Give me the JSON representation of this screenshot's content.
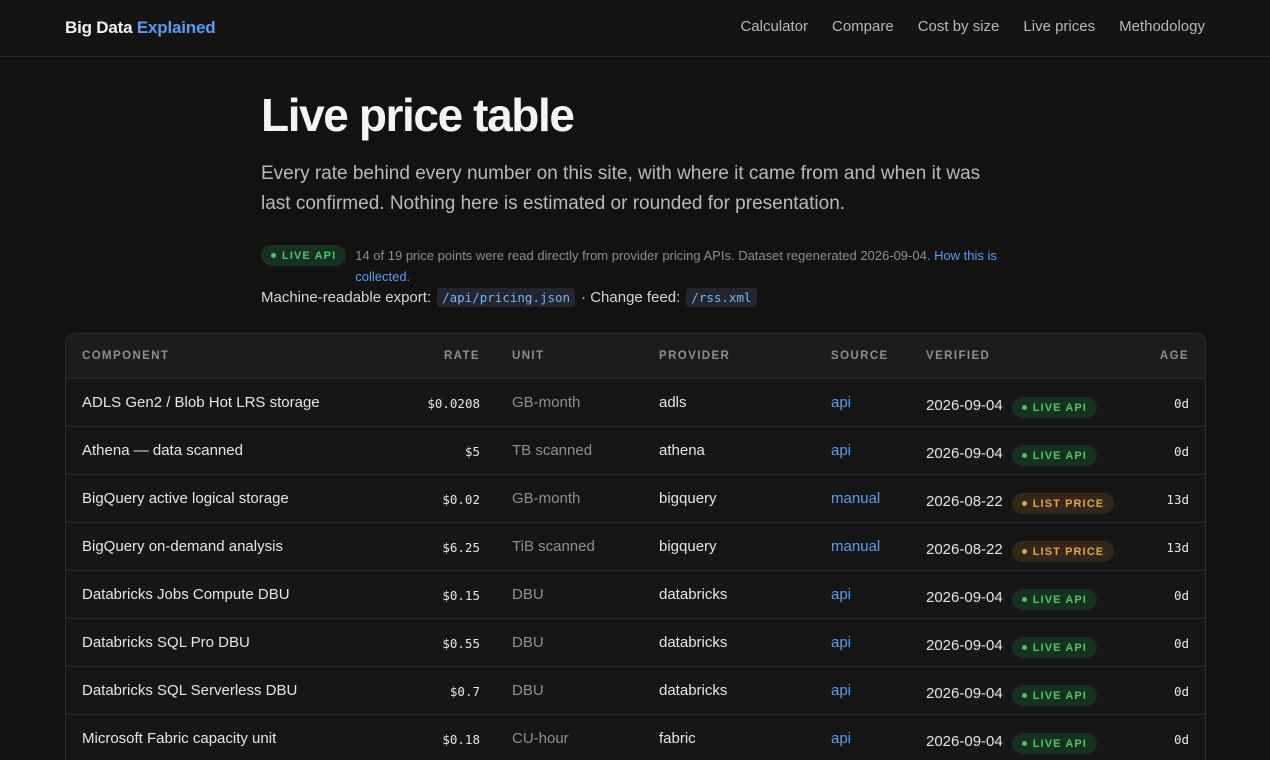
{
  "brand": {
    "name": "Big Data",
    "accent": "Explained"
  },
  "nav": [
    "Calculator",
    "Compare",
    "Cost by size",
    "Live prices",
    "Methodology"
  ],
  "page": {
    "title": "Live price table",
    "lede": "Every rate behind every number on this site, with where it came from and when it was last confirmed. Nothing here is estimated or rounded for presentation.",
    "status_badge": "LIVE API",
    "status_text": "14 of 19 price points were read directly from provider pricing APIs. Dataset regenerated 2026-09-04.",
    "status_link": "How this is collected",
    "export_label": "Machine-readable export:",
    "export_path": "/api/pricing.json",
    "feed_label": "· Change feed:",
    "feed_path": "/rss.xml"
  },
  "table": {
    "headers": {
      "component": "COMPONENT",
      "rate": "RATE",
      "unit": "UNIT",
      "provider": "PROVIDER",
      "source": "SOURCE",
      "verified": "VERIFIED",
      "age": "AGE"
    },
    "rows": [
      {
        "component": "ADLS Gen2 / Blob Hot LRS storage",
        "rate": "$0.0208",
        "unit": "GB-month",
        "provider": "adls",
        "source": "api",
        "verified": "2026-09-04",
        "badge": "LIVE API",
        "badge_type": "live",
        "age": "0d"
      },
      {
        "component": "Athena — data scanned",
        "rate": "$5",
        "unit": "TB scanned",
        "provider": "athena",
        "source": "api",
        "verified": "2026-09-04",
        "badge": "LIVE API",
        "badge_type": "live",
        "age": "0d"
      },
      {
        "component": "BigQuery active logical storage",
        "rate": "$0.02",
        "unit": "GB-month",
        "provider": "bigquery",
        "source": "manual",
        "verified": "2026-08-22",
        "badge": "LIST PRICE",
        "badge_type": "list",
        "age": "13d"
      },
      {
        "component": "BigQuery on-demand analysis",
        "rate": "$6.25",
        "unit": "TiB scanned",
        "provider": "bigquery",
        "source": "manual",
        "verified": "2026-08-22",
        "badge": "LIST PRICE",
        "badge_type": "list",
        "age": "13d"
      },
      {
        "component": "Databricks Jobs Compute DBU",
        "rate": "$0.15",
        "unit": "DBU",
        "provider": "databricks",
        "source": "api",
        "verified": "2026-09-04",
        "badge": "LIVE API",
        "badge_type": "live",
        "age": "0d"
      },
      {
        "component": "Databricks SQL Pro DBU",
        "rate": "$0.55",
        "unit": "DBU",
        "provider": "databricks",
        "source": "api",
        "verified": "2026-09-04",
        "badge": "LIVE API",
        "badge_type": "live",
        "age": "0d"
      },
      {
        "component": "Databricks SQL Serverless DBU",
        "rate": "$0.7",
        "unit": "DBU",
        "provider": "databricks",
        "source": "api",
        "verified": "2026-09-04",
        "badge": "LIVE API",
        "badge_type": "live",
        "age": "0d"
      },
      {
        "component": "Microsoft Fabric capacity unit",
        "rate": "$0.18",
        "unit": "CU-hour",
        "provider": "fabric",
        "source": "api",
        "verified": "2026-09-04",
        "badge": "LIVE API",
        "badge_type": "live",
        "age": "0d"
      }
    ]
  }
}
